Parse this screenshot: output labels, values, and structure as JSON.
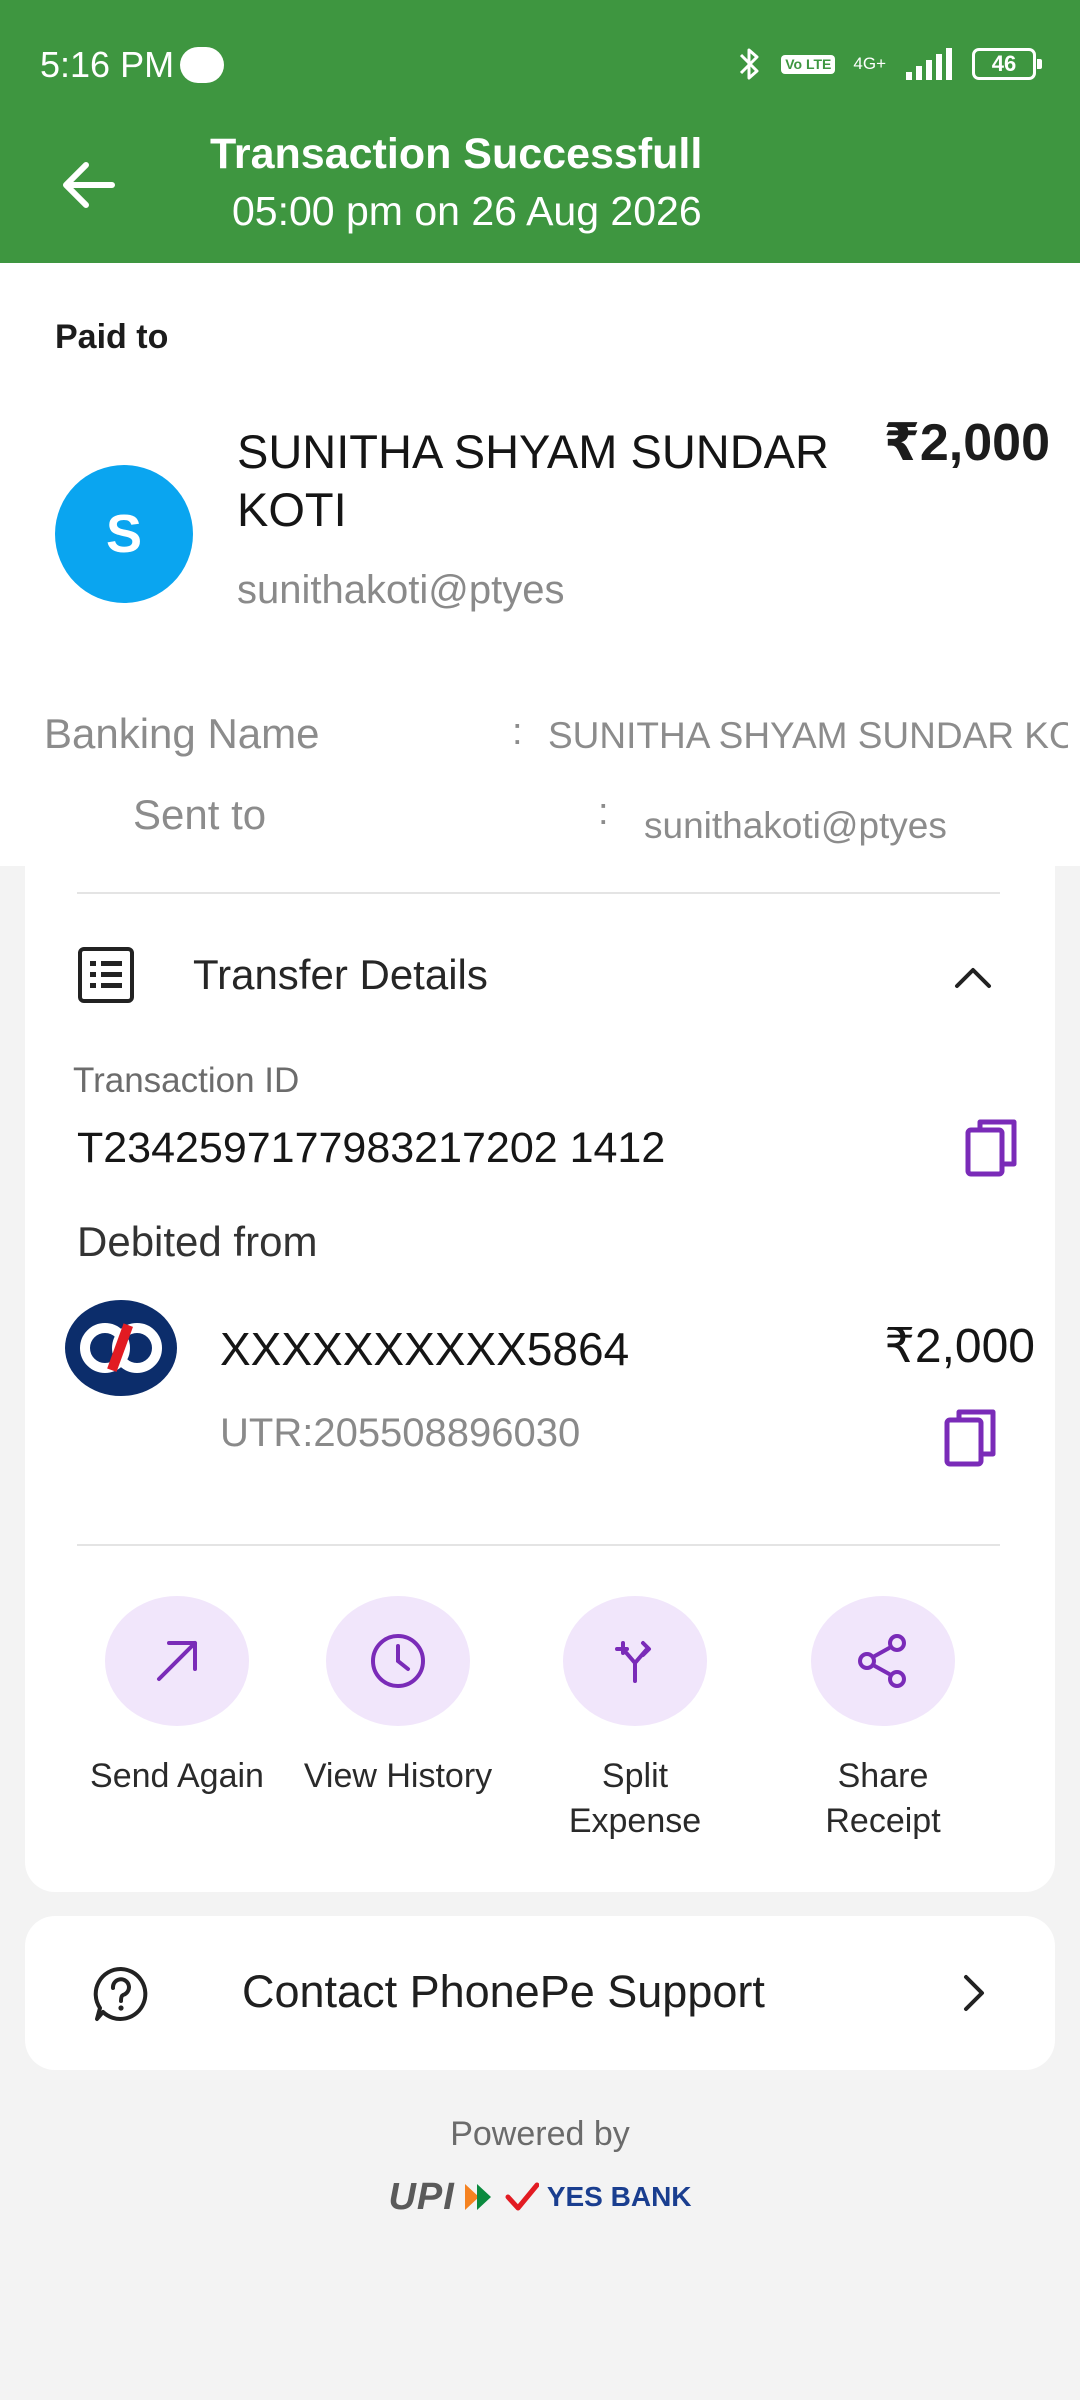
{
  "status_bar": {
    "time": "5:16 PM",
    "volte": "Vo LTE",
    "network": "4G+",
    "battery": "46"
  },
  "header": {
    "title": "Transaction Successfull",
    "subtitle": "05:00 pm on 26 Aug 2026"
  },
  "paid_to": {
    "label": "Paid to",
    "avatar_letter": "S",
    "name": "SUNITHA SHYAM SUNDAR KOTI",
    "amount": "₹2,000",
    "upi_id": "sunithakoti@ptyes",
    "banking_name_label": "Banking Name",
    "banking_name_value": "SUNITHA SHYAM SUNDAR KOTI",
    "sent_to_label": "Sent to",
    "sent_to_value": "sunithakoti@ptyes",
    "separator": ":"
  },
  "transfer_details": {
    "label": "Transfer Details",
    "transaction_id_label": "Transaction ID",
    "transaction_id": "T2342597177983217202 1412",
    "debited_from_label": "Debited from",
    "account": "XXXXXXXXXX5864",
    "amount": "₹2,000",
    "utr": "UTR:205508896030"
  },
  "actions": [
    {
      "label": "Send Again",
      "icon": "arrow-up-right-icon"
    },
    {
      "label": "View History",
      "icon": "clock-icon"
    },
    {
      "label": "Split Expense",
      "icon": "split-icon"
    },
    {
      "label": "Share Receipt",
      "icon": "share-icon"
    }
  ],
  "support": {
    "label": "Contact PhonePe Support"
  },
  "footer": {
    "powered_by": "Powered by",
    "upi": "UPI",
    "bank": "YES BANK"
  },
  "colors": {
    "header_green": "#3e9640",
    "avatar_blue": "#0aa5f0",
    "accent_purple": "#7a2bb8",
    "action_bg": "#f1e6fb"
  }
}
